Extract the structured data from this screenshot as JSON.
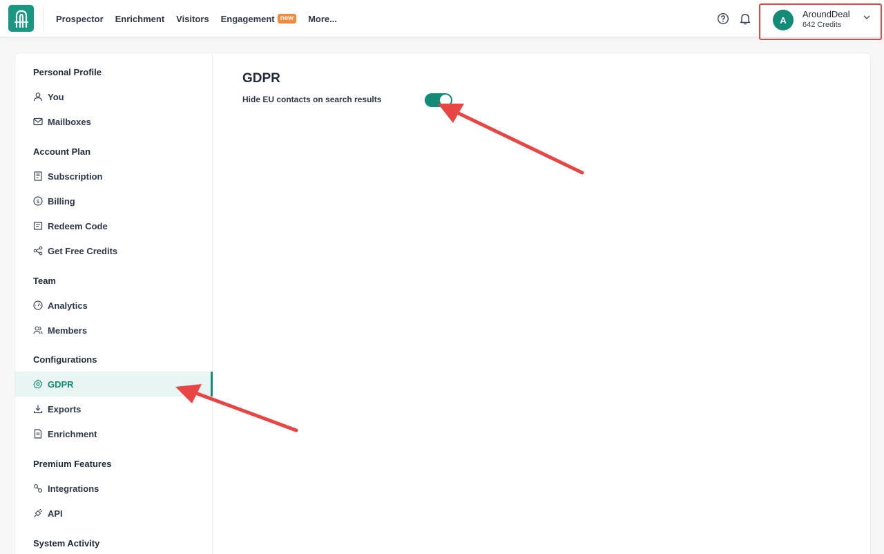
{
  "nav": {
    "items": [
      {
        "label": "Prospector"
      },
      {
        "label": "Enrichment"
      },
      {
        "label": "Visitors"
      },
      {
        "label": "Engagement",
        "badge": "new"
      },
      {
        "label": "More..."
      }
    ]
  },
  "account": {
    "initial": "A",
    "name": "AroundDeal",
    "credits": "642 Credits"
  },
  "sidebar": {
    "sections": [
      {
        "title": "Personal Profile",
        "items": [
          {
            "label": "You",
            "icon": "user-icon"
          },
          {
            "label": "Mailboxes",
            "icon": "mail-icon"
          }
        ]
      },
      {
        "title": "Account Plan",
        "items": [
          {
            "label": "Subscription",
            "icon": "receipt-icon"
          },
          {
            "label": "Billing",
            "icon": "dollar-icon"
          },
          {
            "label": "Redeem Code",
            "icon": "ticket-icon"
          },
          {
            "label": "Get Free Credits",
            "icon": "share-icon"
          }
        ]
      },
      {
        "title": "Team",
        "items": [
          {
            "label": "Analytics",
            "icon": "gauge-icon"
          },
          {
            "label": "Members",
            "icon": "members-icon"
          }
        ]
      },
      {
        "title": "Configurations",
        "items": [
          {
            "label": "GDPR",
            "icon": "gear-icon"
          },
          {
            "label": "Exports",
            "icon": "download-icon"
          },
          {
            "label": "Enrichment",
            "icon": "document-icon"
          }
        ]
      },
      {
        "title": "Premium Features",
        "items": [
          {
            "label": "Integrations",
            "icon": "link-icon"
          },
          {
            "label": "API",
            "icon": "plug-icon"
          }
        ]
      },
      {
        "title": "System Activity",
        "items": []
      }
    ]
  },
  "main": {
    "title": "GDPR",
    "setting_label": "Hide EU contacts on search results",
    "toggle_on": true
  },
  "colors": {
    "brand": "#138b77",
    "annotation": "#e84545",
    "badge": "#f08a3c"
  }
}
